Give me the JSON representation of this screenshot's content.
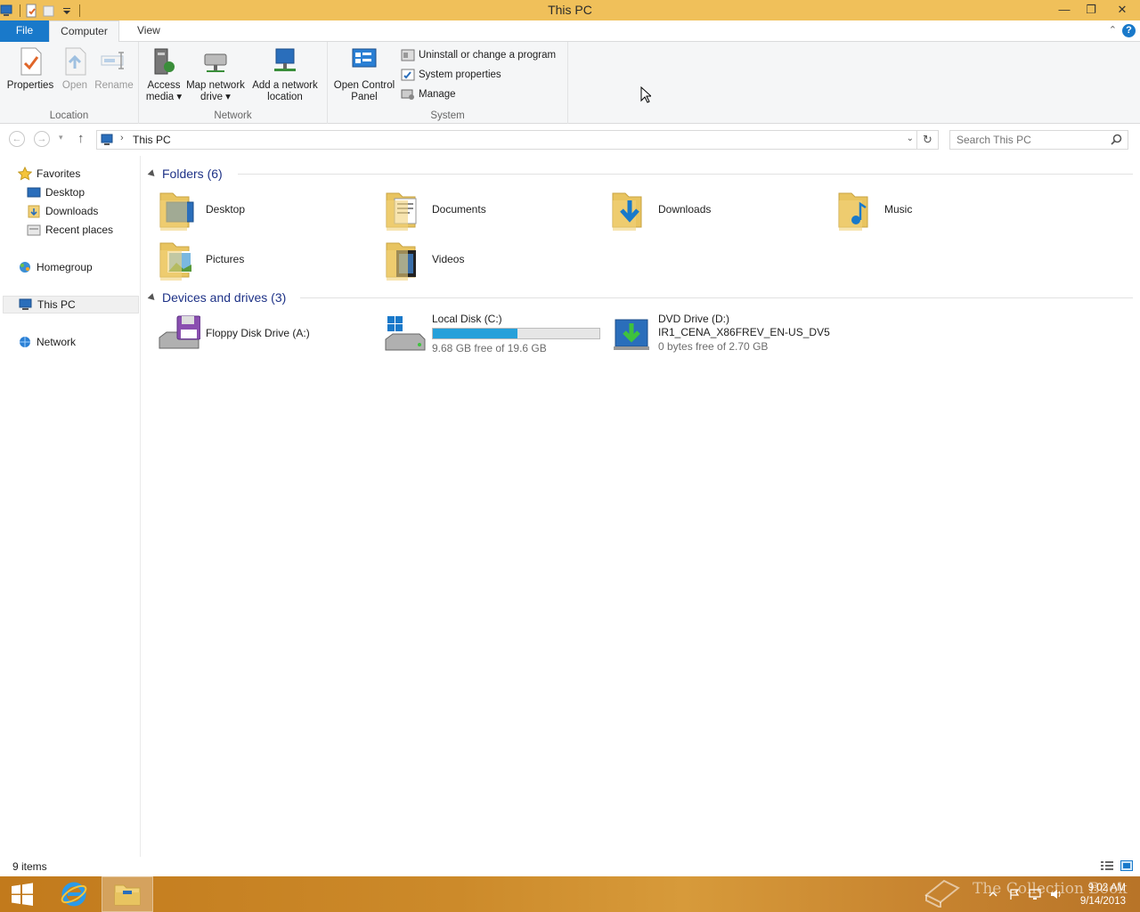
{
  "window": {
    "title": "This PC"
  },
  "ribbon_tabs": {
    "file": "File",
    "computer": "Computer",
    "view": "View"
  },
  "ribbon": {
    "location": {
      "label": "Location",
      "properties": "Properties",
      "open": "Open",
      "rename": "Rename"
    },
    "network": {
      "label": "Network",
      "access_media": "Access media",
      "map_network_drive": "Map network drive",
      "add_network_location": "Add a network location"
    },
    "system": {
      "label": "System",
      "open_control_panel": "Open Control Panel",
      "uninstall": "Uninstall or change a program",
      "system_properties": "System properties",
      "manage": "Manage"
    }
  },
  "address": {
    "path": "This PC",
    "search_placeholder": "Search This PC"
  },
  "nav": {
    "favorites": "Favorites",
    "desktop": "Desktop",
    "downloads": "Downloads",
    "recent_places": "Recent places",
    "homegroup": "Homegroup",
    "this_pc": "This PC",
    "network": "Network"
  },
  "groups": {
    "folders": "Folders (6)",
    "devices": "Devices and drives (3)"
  },
  "folders": [
    {
      "label": "Desktop",
      "icon": "folder-desktop-icon"
    },
    {
      "label": "Documents",
      "icon": "folder-documents-icon"
    },
    {
      "label": "Downloads",
      "icon": "folder-downloads-icon"
    },
    {
      "label": "Music",
      "icon": "folder-music-icon"
    },
    {
      "label": "Pictures",
      "icon": "folder-pictures-icon"
    },
    {
      "label": "Videos",
      "icon": "folder-videos-icon"
    }
  ],
  "drives": [
    {
      "name": "Floppy Disk Drive (A:)"
    },
    {
      "name": "Local Disk (C:)",
      "free": "9.68 GB free of 19.6 GB",
      "used_fraction": 0.506
    },
    {
      "name": "DVD Drive (D:)",
      "volume": "IR1_CENA_X86FREV_EN-US_DV5",
      "free": "0 bytes free of 2.70 GB"
    }
  ],
  "status": {
    "items": "9 items"
  },
  "taskbar": {
    "time": "9:02 AM",
    "date": "9/14/2013",
    "watermark": "The Collection Book"
  },
  "colors": {
    "titlebar": "#f0c05a",
    "file_tab": "#1979ca",
    "drive_bar": "#26a0da",
    "taskbar": "#c88530"
  }
}
